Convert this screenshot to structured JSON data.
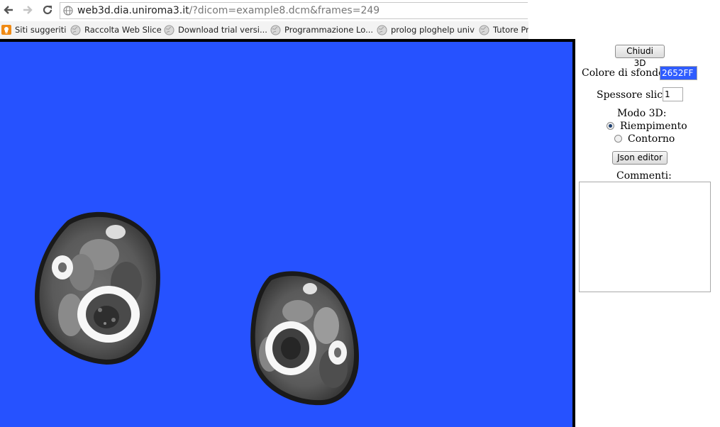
{
  "browser": {
    "url_host": "web3d.dia.uniroma3.it",
    "url_path": "/?dicom=example8.dcm&frames=249",
    "bookmarks": [
      {
        "label": "Siti suggeriti",
        "icon": "suggested-sites-icon"
      },
      {
        "label": "Raccolta Web Slice",
        "icon": "globe-icon"
      },
      {
        "label": "Download trial versi...",
        "icon": "globe-icon"
      },
      {
        "label": "Programmazione Lo...",
        "icon": "globe-icon"
      },
      {
        "label": "prolog ploghelp univ",
        "icon": "globe-icon"
      },
      {
        "label": "Tutore Pr",
        "icon": "globe-icon"
      }
    ]
  },
  "viewer": {
    "background_color": "#2652FF"
  },
  "panel": {
    "close_3d_label": "Chiudi 3D",
    "bg_color_label": "Colore di sfondo:",
    "bg_color_value": "2652FF",
    "slice_thickness_label": "Spessore slice:",
    "slice_thickness_value": "1",
    "mode_label": "Modo 3D:",
    "mode_options": [
      {
        "label": "Riempimento",
        "checked": true
      },
      {
        "label": "Contorno",
        "checked": false
      }
    ],
    "json_editor_label": "Json editor",
    "comments_label": "Commenti:",
    "comments_value": ""
  }
}
